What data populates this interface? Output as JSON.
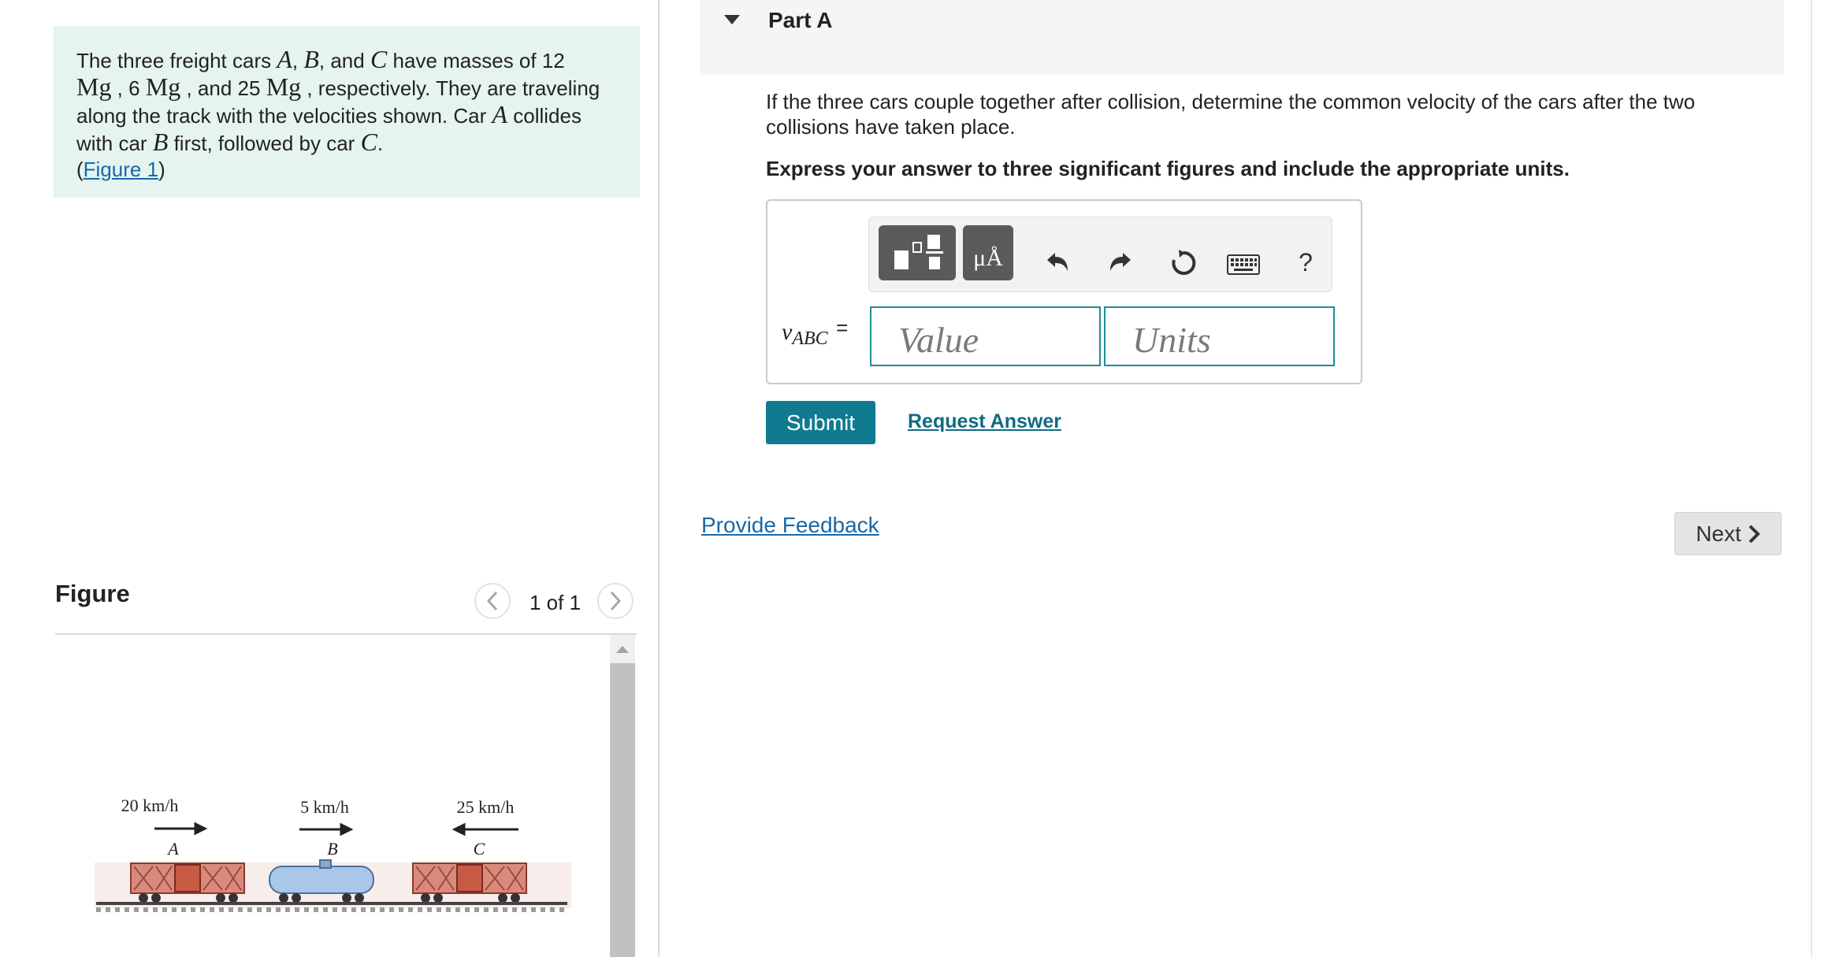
{
  "problem": {
    "text_1": "The three freight cars ",
    "car_a": "A",
    "comma_1": ", ",
    "car_b": "B",
    "and_1": ", and ",
    "car_c": "C",
    "text_2": " have masses of 12",
    "mass_unit_1": "Mg",
    "text_3": " , 6 ",
    "mass_unit_2": "Mg",
    "text_4": " , and 25 ",
    "mass_unit_3": "Mg",
    "text_5": " , respectively. They are traveling",
    "text_6": "along the track with the velocities shown. Car ",
    "car_a_2": "A",
    "text_7": " collides",
    "text_8": "with car ",
    "car_b_2": "B",
    "text_9": " first, followed by car ",
    "car_c_2": "C",
    "text_10": ".",
    "paren_open": "(",
    "figure_link": "Figure 1",
    "paren_close": ")"
  },
  "figure": {
    "title": "Figure",
    "pager": "1 of 1",
    "labels": {
      "speed_a": "20 km/h",
      "speed_b": "5 km/h",
      "speed_c": "25 km/h",
      "car_a": "A",
      "car_b": "B",
      "car_c": "C"
    }
  },
  "part": {
    "title": "Part A",
    "question": "If the three cars couple together after collision, determine the common velocity of the cars after the two collisions have taken place.",
    "instruction": "Express your answer to three significant figures and include the appropriate units."
  },
  "answer": {
    "variable": "v",
    "subscript": "ABC",
    "equals": "=",
    "value_placeholder": "Value",
    "units_placeholder": "Units",
    "symbols_label": "μÅ",
    "help_label": "?"
  },
  "actions": {
    "submit": "Submit",
    "request_answer": "Request Answer",
    "provide_feedback": "Provide Feedback",
    "next": "Next"
  },
  "colors": {
    "problem_bg": "#e6f4ef",
    "submit_bg": "#0f7a90",
    "input_border": "#1f8c99",
    "link": "#1769aa"
  }
}
